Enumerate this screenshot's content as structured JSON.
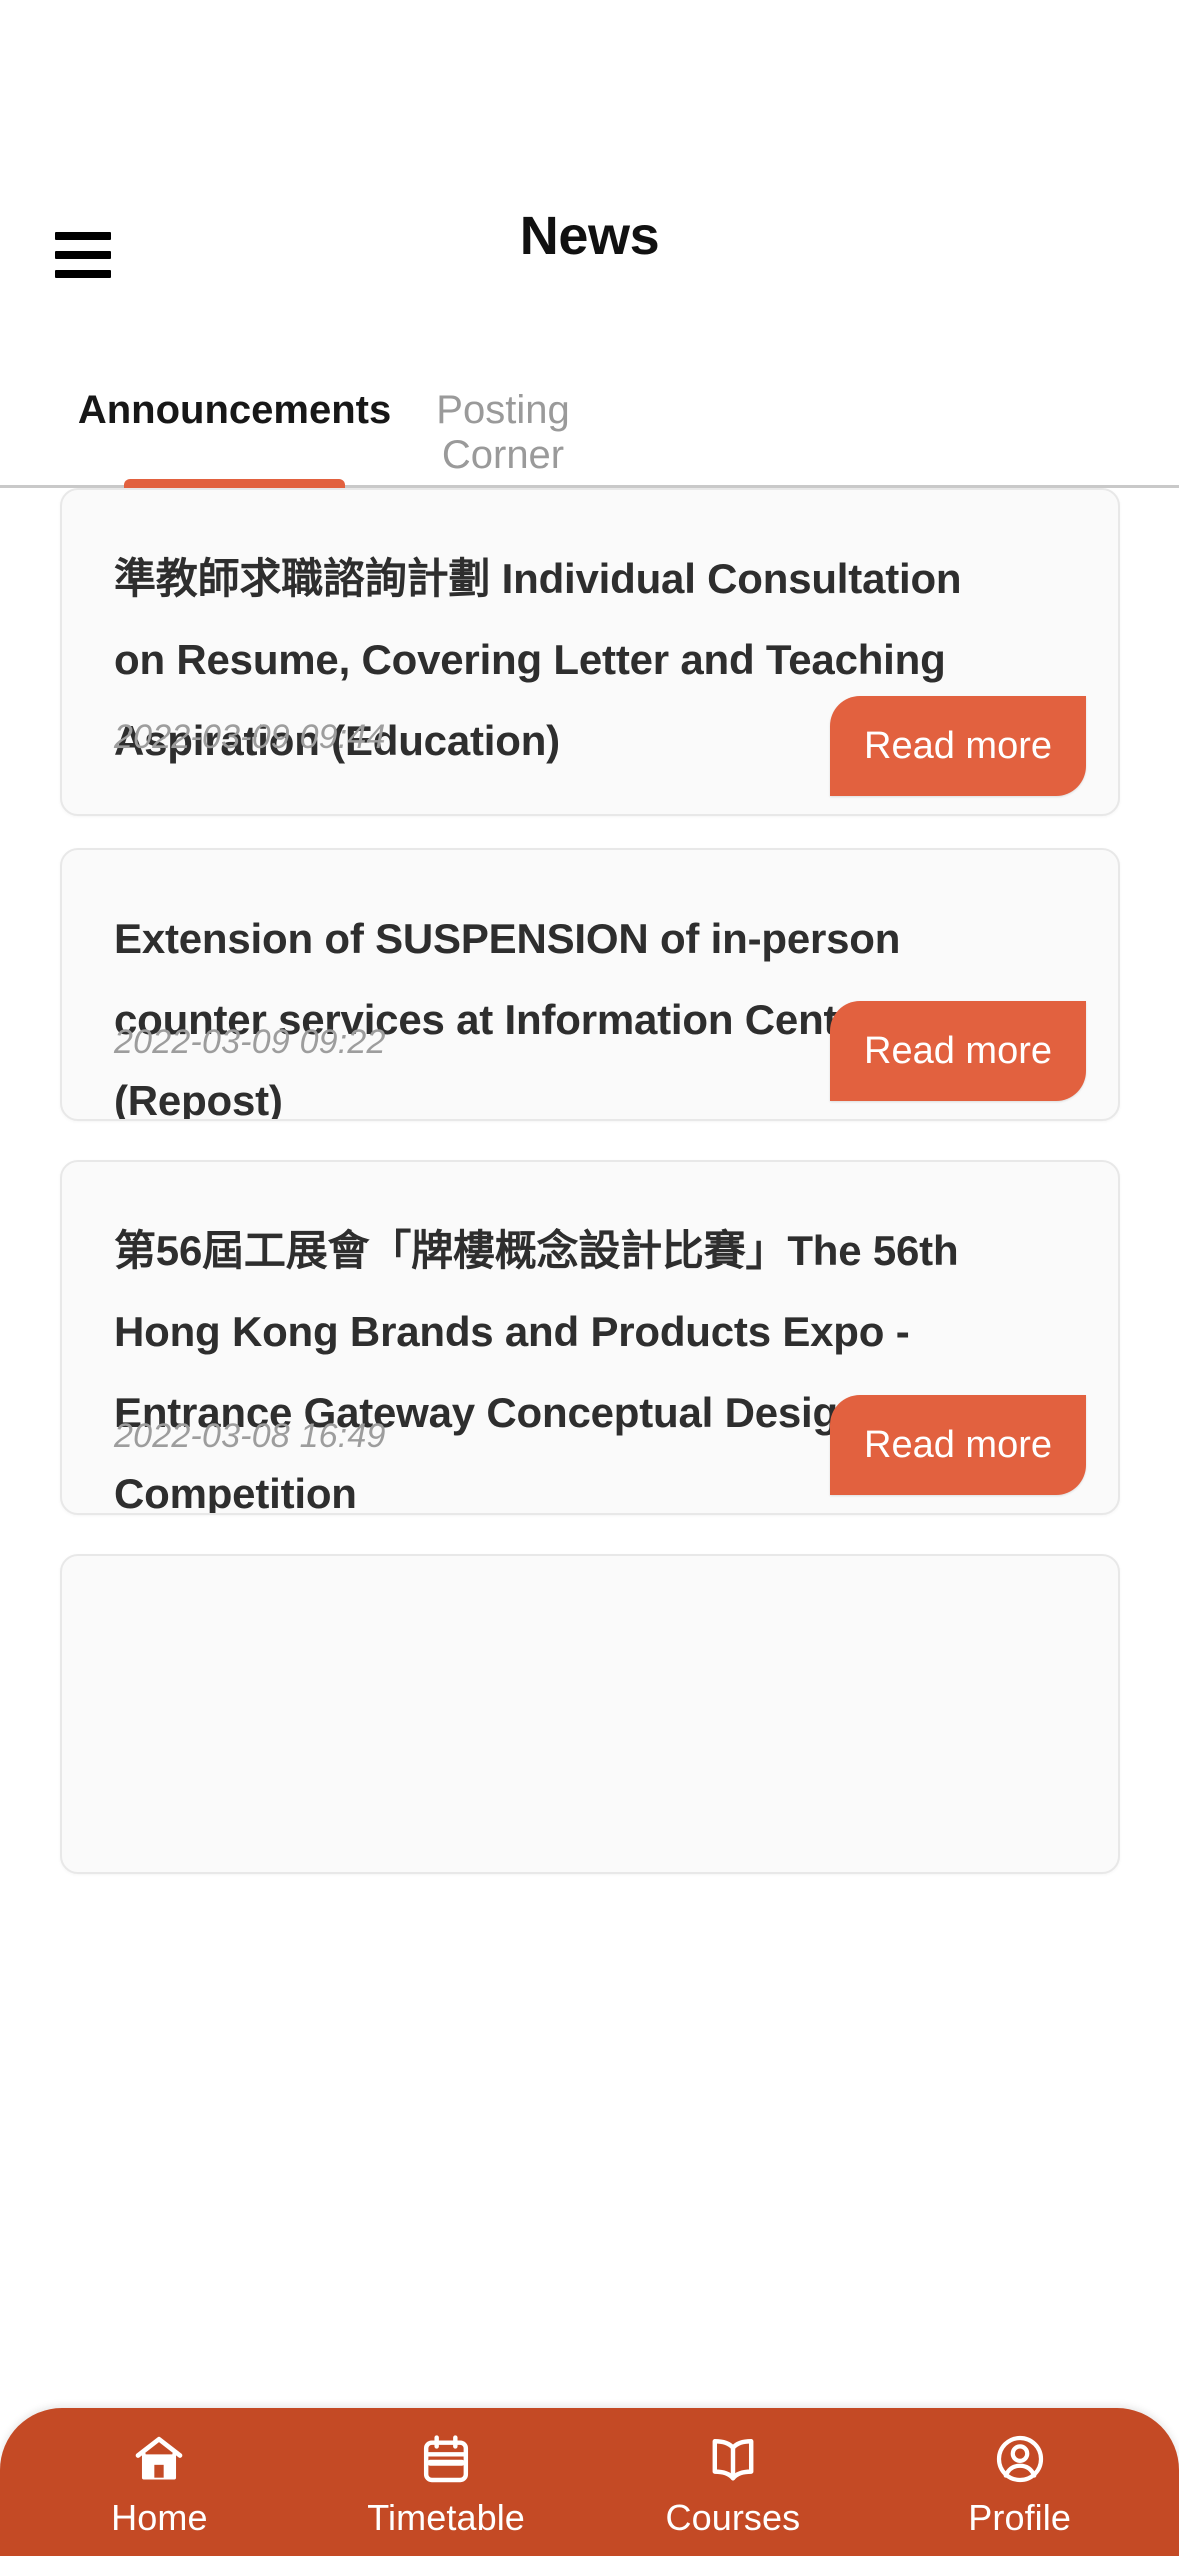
{
  "header": {
    "title": "News",
    "menu_icon": "hamburger-menu-icon"
  },
  "tabs": [
    {
      "label": "Announcements",
      "active": true
    },
    {
      "label": "Posting Corner",
      "active": false
    }
  ],
  "announcements": [
    {
      "title": "準教師求職諮詢計劃 Individual Consultation on Resume, Covering Letter and Teaching Aspiration (Education)",
      "date": "2022-03-09 09:44",
      "read_more_label": "Read more"
    },
    {
      "title": "Extension of SUSPENSION of in-person counter services at Information Centre (Repost)",
      "date": "2022-03-09 09:22",
      "read_more_label": "Read more"
    },
    {
      "title": "第56屆工展會「牌樓概念設計比賽」The 56th Hong Kong Brands and Products Expo - Entrance Gateway Conceptual Design Competition",
      "date": "2022-03-08 16:49",
      "read_more_label": "Read more"
    },
    {
      "title": "",
      "date": "",
      "read_more_label": ""
    }
  ],
  "bottom_nav": [
    {
      "label": "Home",
      "icon": "home-icon"
    },
    {
      "label": "Timetable",
      "icon": "calendar-icon"
    },
    {
      "label": "Courses",
      "icon": "book-icon"
    },
    {
      "label": "Profile",
      "icon": "user-circle-icon"
    }
  ],
  "colors": {
    "accent": "#e2613f",
    "nav_background": "#c44a25",
    "card_background": "#fafafa",
    "active_tab_text": "#171717",
    "inactive_tab_text": "#9a9a9a",
    "date_text": "#9d9d9d"
  }
}
